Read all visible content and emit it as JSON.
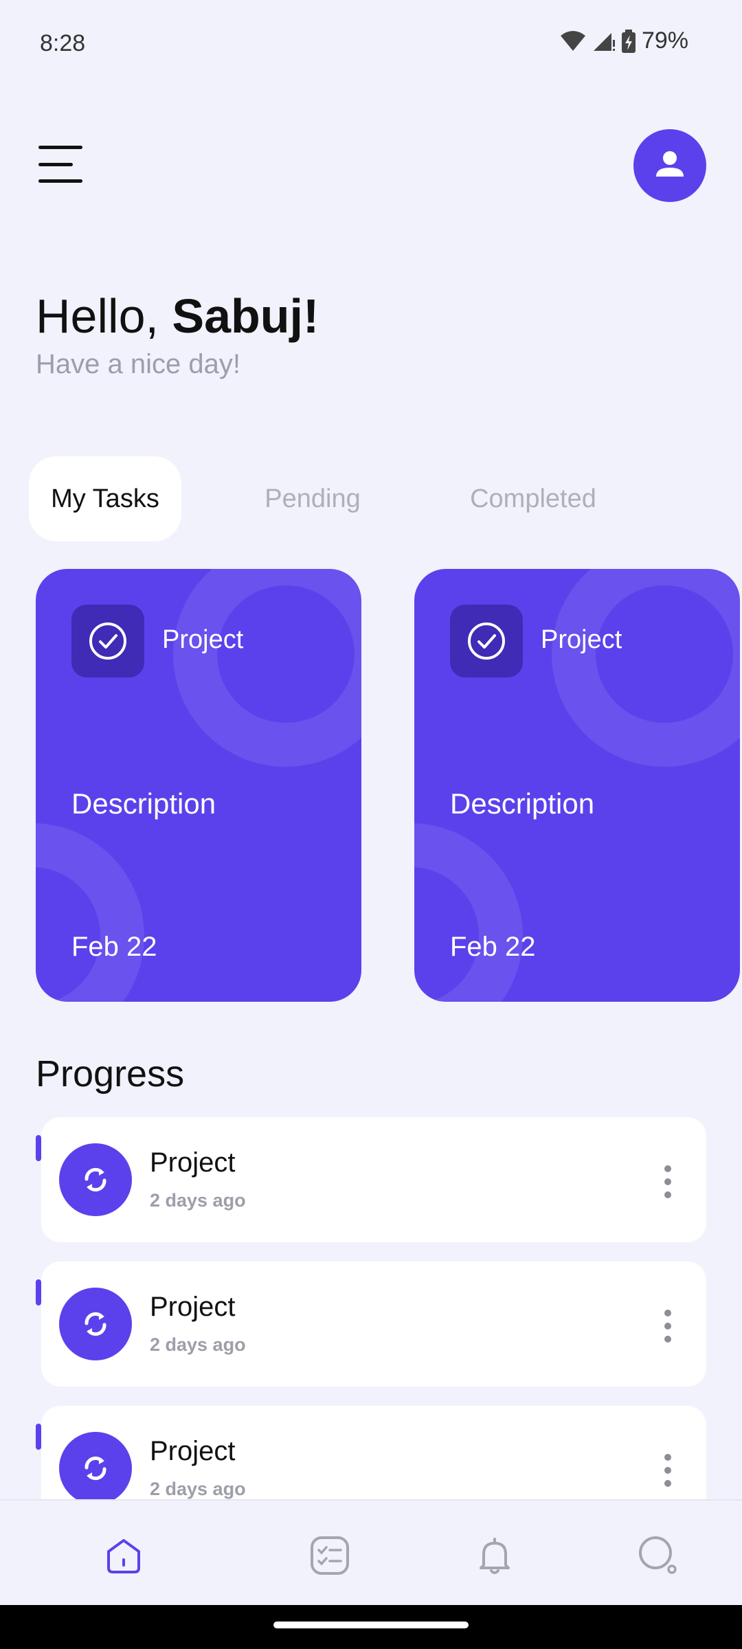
{
  "status_bar": {
    "time": "8:28",
    "battery": "79%"
  },
  "greeting": {
    "hello": "Hello, ",
    "name": "Sabuj!",
    "subtitle": "Have a nice day!"
  },
  "tabs": [
    {
      "label": "My Tasks",
      "active": true
    },
    {
      "label": "Pending",
      "active": false
    },
    {
      "label": "Completed",
      "active": false
    }
  ],
  "cards": [
    {
      "title": "Project",
      "description": "Description",
      "date": "Feb 22",
      "icon": "check-circle-icon"
    },
    {
      "title": "Project",
      "description": "Description",
      "date": "Feb 22",
      "icon": "check-circle-icon"
    }
  ],
  "progress": {
    "title": "Progress",
    "items": [
      {
        "title": "Project",
        "time": "2 days ago",
        "icon": "sync-icon"
      },
      {
        "title": "Project",
        "time": "2 days ago",
        "icon": "sync-icon"
      },
      {
        "title": "Project",
        "time": "2 days ago",
        "icon": "sync-icon"
      }
    ]
  },
  "bottom_nav": [
    {
      "name": "home",
      "icon": "home-icon",
      "active": true
    },
    {
      "name": "tasks",
      "icon": "checklist-icon",
      "active": false
    },
    {
      "name": "notifications",
      "icon": "bell-icon",
      "active": false
    },
    {
      "name": "search",
      "icon": "search-icon",
      "active": false
    }
  ],
  "colors": {
    "accent": "#5B41EC",
    "accent_dark": "#3F2BB5",
    "background": "#F1F2FC",
    "muted": "#9E9EAA"
  }
}
